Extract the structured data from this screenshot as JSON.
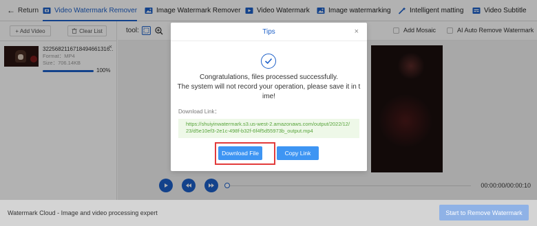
{
  "nav": {
    "back_label": "Return",
    "tabs": [
      {
        "label": "Video Watermark Remover",
        "active": true
      },
      {
        "label": "Image Watermark Remover",
        "active": false
      },
      {
        "label": "Video Watermark",
        "active": false
      },
      {
        "label": "Image watermarking",
        "active": false
      },
      {
        "label": "Intelligent matting",
        "active": false
      },
      {
        "label": "Video Subtitle",
        "active": false
      }
    ]
  },
  "sidebar": {
    "add_label": "+ Add Video",
    "clear_label": "Clear List",
    "files": [
      {
        "name": "3225682116718494661316…",
        "format": "Format：MP4",
        "size": "Size：706.14KB",
        "progress_pct": 100,
        "progress_label": "100%"
      }
    ]
  },
  "toolbar": {
    "tool_label": "tool:",
    "add_mosaic_label": "Add Mosaic",
    "ai_remove_label": "AI Auto Remove Watermark"
  },
  "player": {
    "time_label": "00:00:00/00:00:10"
  },
  "footer": {
    "left_text": "Watermark Cloud - Image and video processing expert",
    "start_label": "Start to Remove Watermark"
  },
  "dialog": {
    "title": "Tips",
    "message_lines": [
      "Congratulations, files processed successfully.",
      "The system will not record your operation, please save it in t",
      "ime!"
    ],
    "link_label": "Download Link：",
    "link_url": "https://shuiyinwatermark.s3.us-west-2.amazonaws.com/output/2022/12/23/d5e10ef3-2e1c-498f-b32f-6f4f5d55973b_output.mp4",
    "download_label": "Download File",
    "copy_label": "Copy Link"
  },
  "colors": {
    "accent": "#1c5fc8",
    "button_blue": "#3e95f3",
    "link_green": "#56a33a",
    "link_bg": "#eef8e8",
    "highlight_red": "#e23a3a"
  }
}
